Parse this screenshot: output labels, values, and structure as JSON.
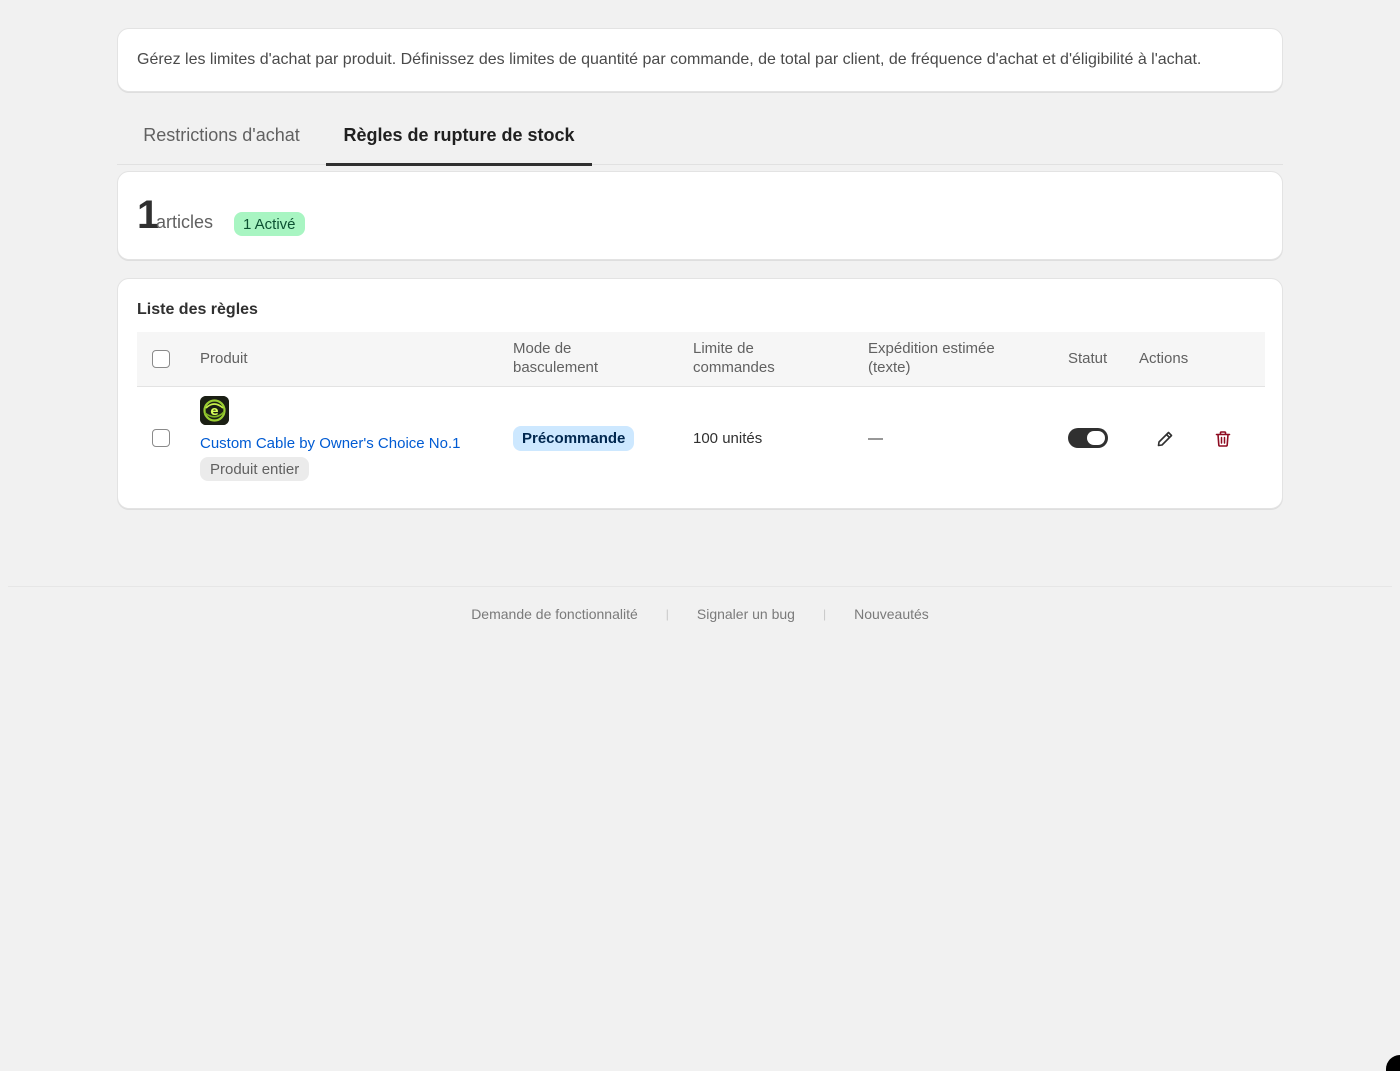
{
  "description": "Gérez les limites d'achat par produit. Définissez des limites de quantité par commande, de total par client, de fréquence d'achat et d'éligibilité à l'achat.",
  "tabs": [
    {
      "label": "Restrictions d'achat",
      "selected": false
    },
    {
      "label": "Règles de rupture de stock",
      "selected": true
    }
  ],
  "stats": {
    "count": "1",
    "count_label": "articles",
    "active_badge": "1 Activé"
  },
  "rules": {
    "title": "Liste des règles",
    "columns": {
      "product": "Produit",
      "mode_l1": "Mode de",
      "mode_l2": "basculement",
      "limit_l1": "Limite de",
      "limit_l2": "commandes",
      "shipping_l1": "Expédition estimée",
      "shipping_l2": "(texte)",
      "status": "Statut",
      "actions": "Actions"
    },
    "rows": [
      {
        "product_name": "Custom Cable by Owner's Choice No.1",
        "scope": "Produit entier",
        "mode": "Précommande",
        "limit": "100 unités",
        "shipping": "—",
        "status_enabled": true
      }
    ]
  },
  "footer": {
    "feature_request": "Demande de fonctionnalité",
    "report_bug": "Signaler un bug",
    "whats_new": "Nouveautés",
    "separator": "|"
  },
  "colors": {
    "link": "#005bd3",
    "active_badge_bg": "#a8f5c2",
    "mode_badge_bg": "#cde8ff",
    "delete_icon": "#8e0b21"
  }
}
